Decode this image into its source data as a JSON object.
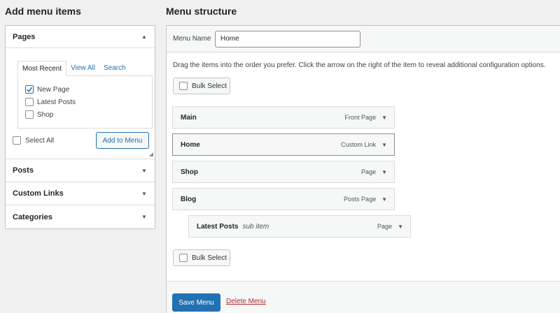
{
  "left": {
    "heading": "Add menu items",
    "pages": {
      "title": "Pages",
      "tabs": [
        "Most Recent",
        "View All",
        "Search"
      ],
      "items": [
        {
          "label": "New Page",
          "checked": true
        },
        {
          "label": "Latest Posts",
          "checked": false
        },
        {
          "label": "Shop",
          "checked": false
        }
      ],
      "select_all": "Select All",
      "add_button": "Add to Menu"
    },
    "sections": [
      "Posts",
      "Custom Links",
      "Categories"
    ]
  },
  "right": {
    "heading": "Menu structure",
    "menu_name_label": "Menu Name",
    "menu_name_value": "Home",
    "help_text": "Drag the items into the order you prefer. Click the arrow on the right of the item to reveal additional configuration options.",
    "bulk_select": "Bulk Select",
    "items": [
      {
        "title": "Main",
        "sub": "",
        "type": "Front Page"
      },
      {
        "title": "Home",
        "sub": "",
        "type": "Custom Link"
      },
      {
        "title": "Shop",
        "sub": "",
        "type": "Page"
      },
      {
        "title": "Blog",
        "sub": "",
        "type": "Posts Page"
      },
      {
        "title": "Latest Posts",
        "sub": "sub item",
        "type": "Page"
      }
    ],
    "save_button": "Save Menu",
    "delete_link": "Delete Menu"
  },
  "icons": {
    "collapse": "triangle-up-icon",
    "expand": "triangle-down-icon",
    "check": "checkmark-icon",
    "resize": "resize-grip-icon"
  },
  "colors": {
    "accent": "#2271b1",
    "danger": "#b32d2e",
    "background": "#f0f0f1"
  }
}
